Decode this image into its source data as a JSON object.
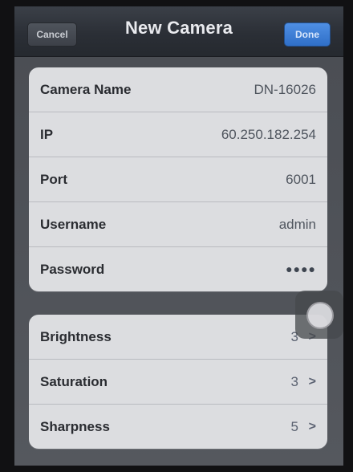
{
  "navbar": {
    "title": "New Camera",
    "cancel_label": "Cancel",
    "done_label": "Done"
  },
  "camera_fields": [
    {
      "label": "Camera Name",
      "value": "DN-16026"
    },
    {
      "label": "IP",
      "value": "60.250.182.254"
    },
    {
      "label": "Port",
      "value": "6001"
    },
    {
      "label": "Username",
      "value": "admin"
    },
    {
      "label": "Password",
      "value": "●●●●"
    }
  ],
  "image_settings": [
    {
      "label": "Brightness",
      "value": "3"
    },
    {
      "label": "Saturation",
      "value": "3"
    },
    {
      "label": "Sharpness",
      "value": "5"
    }
  ],
  "icons": {
    "chevron": "chevron-right-icon",
    "assistive_touch": "assistive-touch-icon"
  },
  "colors": {
    "done_button": "#2f6fc8",
    "navbar": "#2b2f36",
    "group_background": "#dcdde0"
  }
}
